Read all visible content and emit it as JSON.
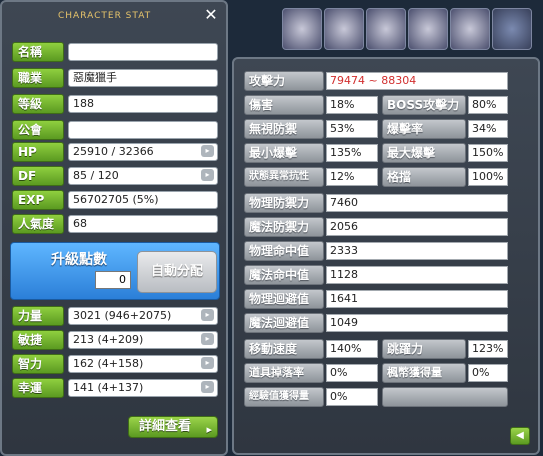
{
  "window": {
    "title": "CHARACTER STAT",
    "close": "✕"
  },
  "basic": [
    {
      "label": "名稱",
      "value": ""
    },
    {
      "label": "職業",
      "value": "惡魔獵手"
    },
    {
      "label": "等級",
      "value": "188"
    },
    {
      "label": "公會",
      "value": ""
    },
    {
      "label": "HP",
      "value": "25910 / 32366"
    },
    {
      "label": "DF",
      "value": "85 / 120"
    },
    {
      "label": "EXP",
      "value": "56702705 (5%)"
    },
    {
      "label": "人氣度",
      "value": "68"
    }
  ],
  "ability_points": {
    "label": "升級點數",
    "value": "0",
    "auto_button": "自動分配"
  },
  "stats": [
    {
      "label": "力量",
      "value": "3021 (946+2075)"
    },
    {
      "label": "敏捷",
      "value": "213 (4+209)"
    },
    {
      "label": "智力",
      "value": "162 (4+158)"
    },
    {
      "label": "幸運",
      "value": "141 (4+137)"
    }
  ],
  "detail_button": "詳細查看",
  "detail": {
    "attack": {
      "label": "攻擊力",
      "value": "79474 ~ 88304"
    },
    "pairs": [
      [
        {
          "label": "傷害",
          "value": "18%"
        },
        {
          "label": "BOSS攻擊力",
          "value": "80%"
        }
      ],
      [
        {
          "label": "無視防禦",
          "value": "53%"
        },
        {
          "label": "爆擊率",
          "value": "34%"
        }
      ],
      [
        {
          "label": "最小爆擊",
          "value": "135%"
        },
        {
          "label": "最大爆擊",
          "value": "150%"
        }
      ],
      [
        {
          "label": "狀態異常抗性",
          "value": "12%"
        },
        {
          "label": "格擋",
          "value": "100%"
        }
      ]
    ],
    "singles": [
      {
        "label": "物理防禦力",
        "value": "7460"
      },
      {
        "label": "魔法防禦力",
        "value": "2056"
      },
      {
        "label": "物理命中值",
        "value": "2333"
      },
      {
        "label": "魔法命中值",
        "value": "1128"
      },
      {
        "label": "物理迴避值",
        "value": "1641"
      },
      {
        "label": "魔法迴避值",
        "value": "1049"
      }
    ],
    "pairs2": [
      [
        {
          "label": "移動速度",
          "value": "140%"
        },
        {
          "label": "跳躍力",
          "value": "123%"
        }
      ],
      [
        {
          "label": "道具掉落率",
          "value": "0%"
        },
        {
          "label": "楓幣獲得量",
          "value": "0%"
        }
      ]
    ],
    "last": {
      "label": "經驗值獲得量",
      "value": "0%"
    }
  },
  "icons": [
    "buff-icon-1",
    "buff-icon-2",
    "buff-icon-3",
    "buff-icon-4",
    "buff-icon-5",
    "buff-icon-6"
  ],
  "colors": {
    "accent_green": "#6fb52c",
    "attack_red": "#d12e2e",
    "points_blue": "#2b7fd8"
  }
}
